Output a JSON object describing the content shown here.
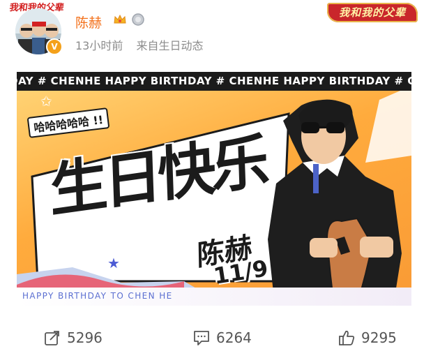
{
  "corner_logo": "我和我的父辈",
  "top_badge": "我和我的父辈",
  "user": {
    "name": "陈赫",
    "verified_mark": "V"
  },
  "post": {
    "time": "13小时前",
    "source": "来自生日动态"
  },
  "banner": {
    "ticker": "RTHDAY # CHENHE HAPPY BIRTHDAY # CHENHE HAPPY BIRTHDAY # CHENHE HAPPY BIRTH",
    "haha": "哈哈哈哈哈 !!",
    "title": "生日快乐",
    "name": "陈赫",
    "date": "11/9",
    "footer": "HAPPY BIRTHDAY TO CHEN HE"
  },
  "actions": {
    "share_count": "5296",
    "comment_count": "6264",
    "like_count": "9295"
  },
  "icons": {
    "share": "share-icon",
    "comment": "comment-icon",
    "like": "thumbs-up-icon",
    "crown": "crown-badge-icon",
    "medal": "silver-medal-icon"
  },
  "colors": {
    "username": "#f3701a",
    "meta": "#8c8c8c",
    "banner_orange": "#f99a35",
    "action_text": "#555555"
  }
}
